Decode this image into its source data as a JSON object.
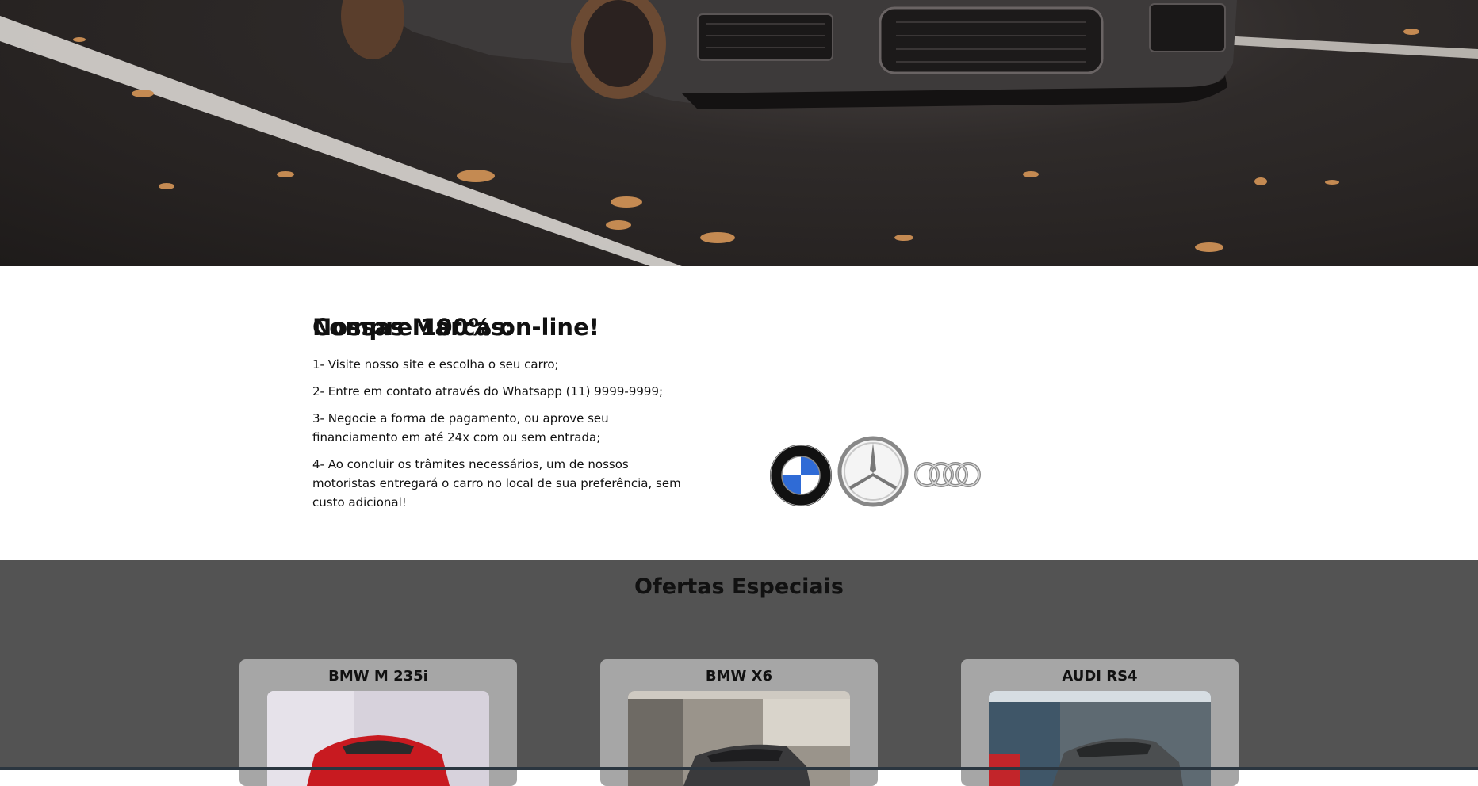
{
  "info": {
    "title": "Compre 100% on-line!",
    "steps": [
      "1- Visite nosso site e escolha o seu carro;",
      "2- Entre em contato através do Whatsapp (11) 9999-9999;",
      "3- Negocie a forma de pagamento, ou aprove seu financiamento em até 24x com ou sem entrada;",
      "4- Ao concluir os trâmites necessários, um de nossos motoristas entregará o carro no local de sua preferência, sem custo adicional!"
    ],
    "brands_title": "Nossas Marcas:",
    "brands": [
      "bmw-logo",
      "mercedes-benz-logo",
      "audi-logo"
    ]
  },
  "offers": {
    "title": "Ofertas Especiais",
    "cards": [
      {
        "name": "BMW M 235i"
      },
      {
        "name": "BMW X6"
      },
      {
        "name": "AUDI RS4"
      }
    ]
  },
  "colors": {
    "offers_bg": "#535353",
    "card_bg": "#a6a6a6"
  }
}
